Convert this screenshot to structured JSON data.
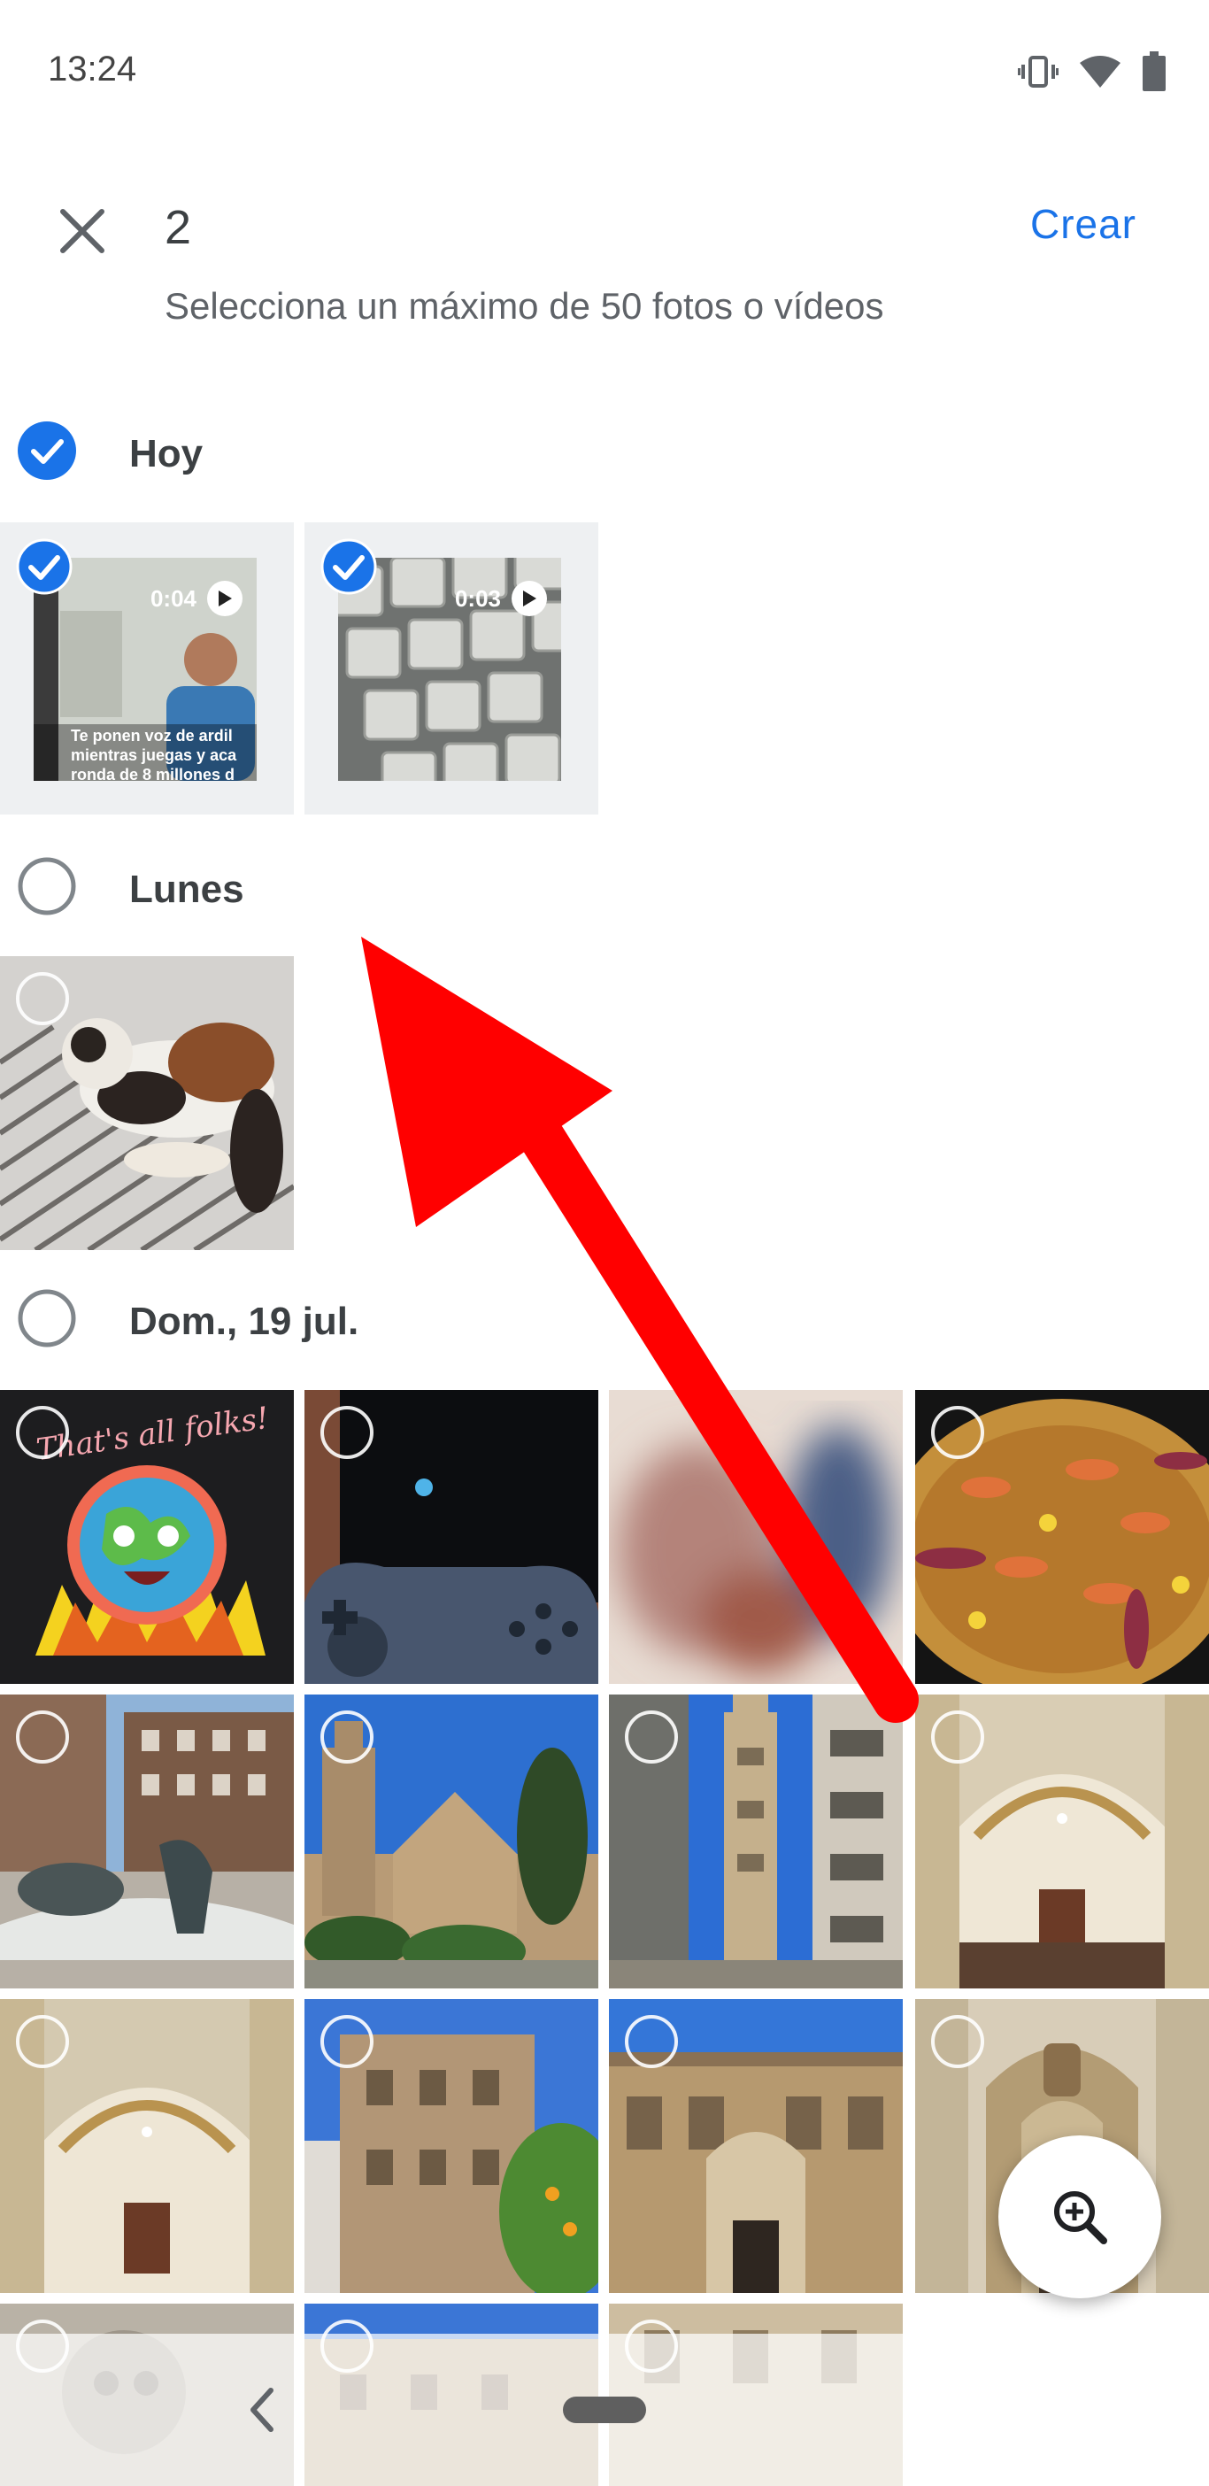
{
  "status_bar": {
    "time": "13:24",
    "icons": [
      "vibrate-icon",
      "wifi-icon",
      "battery-icon"
    ]
  },
  "header": {
    "selected_count": "2",
    "create_label": "Crear",
    "subtitle": "Selecciona un máximo de 50 fotos o vídeos"
  },
  "sections": [
    {
      "label": "Hoy",
      "selected": true,
      "items": [
        {
          "kind": "video",
          "duration": "0:04",
          "selected": true,
          "caption": "Te ponen voz de ardil mientras juegas y aca ronda de 8 millones d"
        },
        {
          "kind": "video",
          "duration": "0:03",
          "selected": true
        }
      ]
    },
    {
      "label": "Lunes",
      "selected": false,
      "items": [
        {
          "kind": "photo",
          "selected": false,
          "subject": "cat"
        }
      ]
    },
    {
      "label": "Dom., 19 jul.",
      "selected": false,
      "items": [
        {
          "kind": "photo",
          "selected": false,
          "text": "That's all folks!"
        },
        {
          "kind": "photo",
          "selected": false,
          "subject": "controller"
        },
        {
          "kind": "photo",
          "selected": false,
          "subject": "blurred"
        },
        {
          "kind": "photo",
          "selected": false,
          "subject": "paella"
        },
        {
          "kind": "photo",
          "selected": false,
          "subject": "fountain"
        },
        {
          "kind": "photo",
          "selected": false,
          "subject": "cathedral"
        },
        {
          "kind": "photo",
          "selected": false,
          "subject": "tower"
        },
        {
          "kind": "photo",
          "selected": false,
          "subject": "church-interior"
        },
        {
          "kind": "photo",
          "selected": false,
          "subject": "church-interior"
        },
        {
          "kind": "photo",
          "selected": false,
          "subject": "palace"
        },
        {
          "kind": "photo",
          "selected": false,
          "subject": "palace-facade"
        },
        {
          "kind": "photo",
          "selected": false,
          "subject": "ornate-facade"
        },
        {
          "kind": "photo",
          "selected": false,
          "subject": "sculpture"
        },
        {
          "kind": "photo",
          "selected": false,
          "subject": "building"
        },
        {
          "kind": "photo",
          "selected": false,
          "subject": "building"
        }
      ]
    }
  ],
  "fab": {
    "icon": "zoom-in-icon"
  },
  "nav": {
    "back_icon": "back-icon",
    "home_icon": "home-pill-icon"
  },
  "colors": {
    "accent": "#1a73e8",
    "arrow": "#ff0000"
  }
}
